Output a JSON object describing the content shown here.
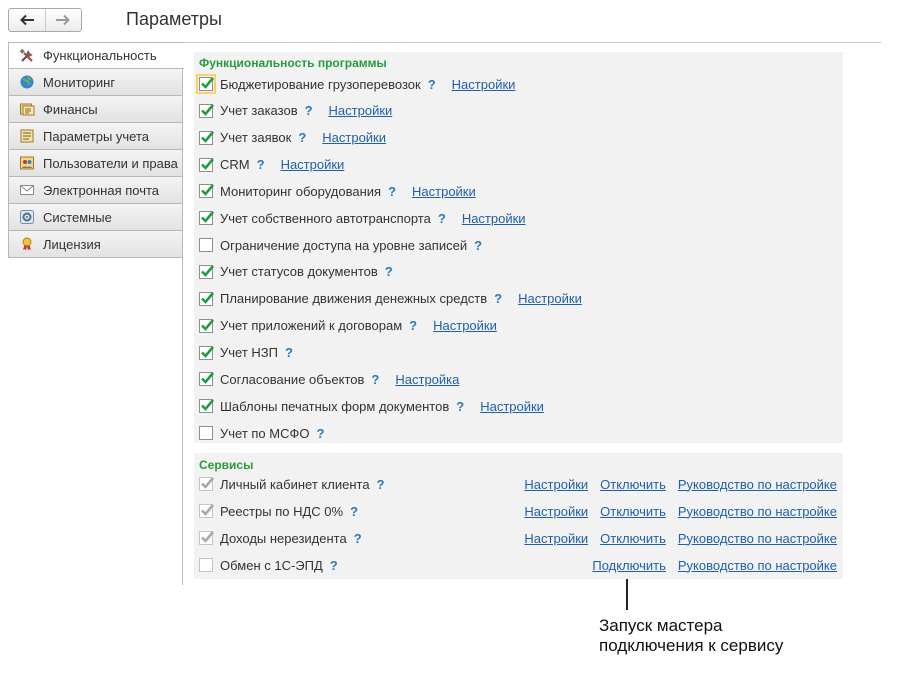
{
  "toolbar": {
    "title": "Параметры"
  },
  "sidebar": {
    "items": [
      {
        "label": "Функциональность",
        "icon": "wrench-screwdriver-icon",
        "active": true
      },
      {
        "label": "Мониторинг",
        "icon": "globe-icon"
      },
      {
        "label": "Финансы",
        "icon": "finance-icon"
      },
      {
        "label": "Параметры учета",
        "icon": "settings-sheet-icon"
      },
      {
        "label": "Пользователи и права",
        "icon": "users-icon"
      },
      {
        "label": "Электронная почта",
        "icon": "envelope-icon"
      },
      {
        "label": "Системные",
        "icon": "system-gear-icon"
      },
      {
        "label": "Лицензия",
        "icon": "license-icon"
      }
    ]
  },
  "functionality": {
    "title": "Функциональность программы",
    "items": [
      {
        "label": "Бюджетирование грузоперевозок",
        "checked": true,
        "help": "?",
        "settings": "Настройки"
      },
      {
        "label": "Учет заказов",
        "checked": true,
        "help": "?",
        "settings": "Настройки"
      },
      {
        "label": "Учет заявок",
        "checked": true,
        "help": "?",
        "settings": "Настройки"
      },
      {
        "label": "CRM",
        "checked": true,
        "help": "?",
        "settings": "Настройки"
      },
      {
        "label": "Мониторинг оборудования",
        "checked": true,
        "help": "?",
        "settings": "Настройки"
      },
      {
        "label": "Учет собственного автотранспорта",
        "checked": true,
        "help": "?",
        "settings": "Настройки"
      },
      {
        "label": "Ограничение доступа на уровне записей",
        "checked": false,
        "help": "?",
        "settings": ""
      },
      {
        "label": "Учет статусов документов",
        "checked": true,
        "help": "?",
        "settings": ""
      },
      {
        "label": "Планирование движения денежных средств",
        "checked": true,
        "help": "?",
        "settings": "Настройки"
      },
      {
        "label": "Учет приложений к договорам",
        "checked": true,
        "help": "?",
        "settings": "Настройки"
      },
      {
        "label": "Учет НЗП",
        "checked": true,
        "help": "?",
        "settings": ""
      },
      {
        "label": "Согласование объектов",
        "checked": true,
        "help": "?",
        "settings": "Настройка"
      },
      {
        "label": "Шаблоны печатных форм документов",
        "checked": true,
        "help": "?",
        "settings": "Настройки"
      },
      {
        "label": "Учет по МСФО",
        "checked": false,
        "help": "?",
        "settings": ""
      }
    ]
  },
  "services": {
    "title": "Сервисы",
    "items": [
      {
        "label": "Личный кабинет клиента",
        "checked": true,
        "help": "?",
        "links": [
          "Настройки",
          "Отключить",
          "Руководство по настройке"
        ]
      },
      {
        "label": "Реестры по НДС 0%",
        "checked": true,
        "help": "?",
        "links": [
          "Настройки",
          "Отключить",
          "Руководство по настройке"
        ]
      },
      {
        "label": "Доходы нерезидента",
        "checked": true,
        "help": "?",
        "links": [
          "Настройки",
          "Отключить",
          "Руководство по настройке"
        ]
      },
      {
        "label": "Обмен с 1С-ЭПД",
        "checked": false,
        "help": "?",
        "links": [
          "Подключить",
          "Руководство по настройке"
        ]
      }
    ]
  },
  "callout": {
    "line1": "Запуск мастера",
    "line2": "подключения к сервису"
  },
  "colors": {
    "group_title": "#2a9a3e",
    "checkmark": "#1e9e3a",
    "link": "#1f5fa9",
    "help": "#2a7ab8",
    "panel": "#f2f2f2"
  }
}
